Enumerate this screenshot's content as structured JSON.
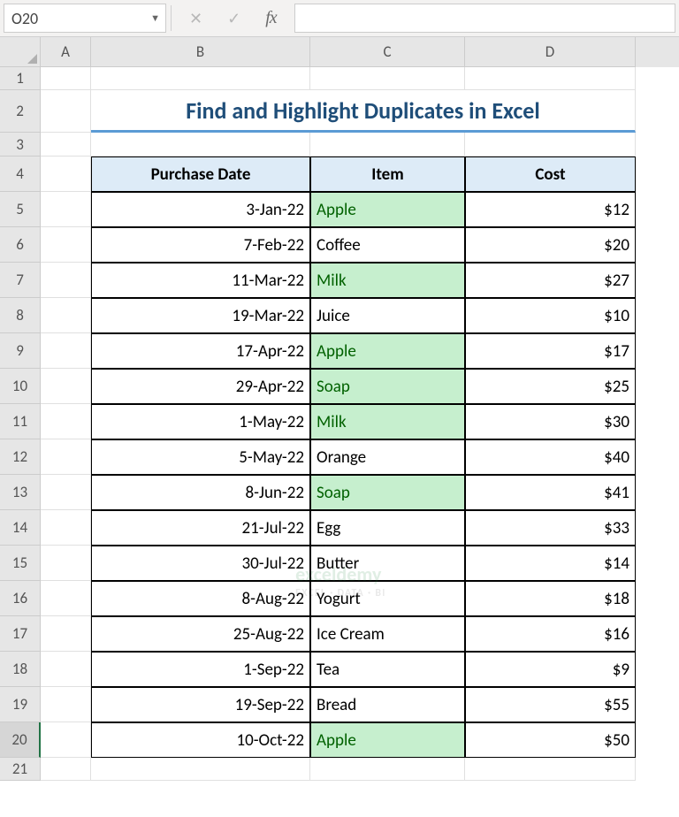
{
  "nameBox": "O20",
  "fxLabel": "fx",
  "cols": [
    "A",
    "B",
    "C",
    "D"
  ],
  "title": "Find and Highlight Duplicates in Excel",
  "headers": {
    "b": "Purchase Date",
    "c": "Item",
    "d": "Cost"
  },
  "rowHeights": {
    "r1": 26,
    "r2": 48,
    "r3": 27,
    "data": 40
  },
  "rows": [
    {
      "n": "1"
    },
    {
      "n": "2"
    },
    {
      "n": "3"
    },
    {
      "n": "4"
    },
    {
      "n": "5",
      "b": "3-Jan-22",
      "c": "Apple",
      "d": "$12",
      "hl": true
    },
    {
      "n": "6",
      "b": "7-Feb-22",
      "c": "Coffee",
      "d": "$20",
      "hl": false
    },
    {
      "n": "7",
      "b": "11-Mar-22",
      "c": "Milk",
      "d": "$27",
      "hl": true
    },
    {
      "n": "8",
      "b": "19-Mar-22",
      "c": "Juice",
      "d": "$10",
      "hl": false
    },
    {
      "n": "9",
      "b": "17-Apr-22",
      "c": "Apple",
      "d": "$17",
      "hl": true
    },
    {
      "n": "10",
      "b": "29-Apr-22",
      "c": "Soap",
      "d": "$25",
      "hl": true
    },
    {
      "n": "11",
      "b": "1-May-22",
      "c": "Milk",
      "d": "$30",
      "hl": true
    },
    {
      "n": "12",
      "b": "5-May-22",
      "c": "Orange",
      "d": "$40",
      "hl": false
    },
    {
      "n": "13",
      "b": "8-Jun-22",
      "c": "Soap",
      "d": "$41",
      "hl": true
    },
    {
      "n": "14",
      "b": "21-Jul-22",
      "c": "Egg",
      "d": "$33",
      "hl": false
    },
    {
      "n": "15",
      "b": "30-Jul-22",
      "c": "Butter",
      "d": "$14",
      "hl": false
    },
    {
      "n": "16",
      "b": "8-Aug-22",
      "c": "Yogurt",
      "d": "$18",
      "hl": false
    },
    {
      "n": "17",
      "b": "25-Aug-22",
      "c": "Ice Cream",
      "d": "$16",
      "hl": false
    },
    {
      "n": "18",
      "b": "1-Sep-22",
      "c": "Tea",
      "d": "$9",
      "hl": false
    },
    {
      "n": "19",
      "b": "19-Sep-22",
      "c": "Bread",
      "d": "$55",
      "hl": false
    },
    {
      "n": "20",
      "b": "10-Oct-22",
      "c": "Apple",
      "d": "$50",
      "hl": true
    },
    {
      "n": "21"
    }
  ],
  "watermark": {
    "main": "exceldemy",
    "sub": "EXCEL · DATA · BI"
  }
}
